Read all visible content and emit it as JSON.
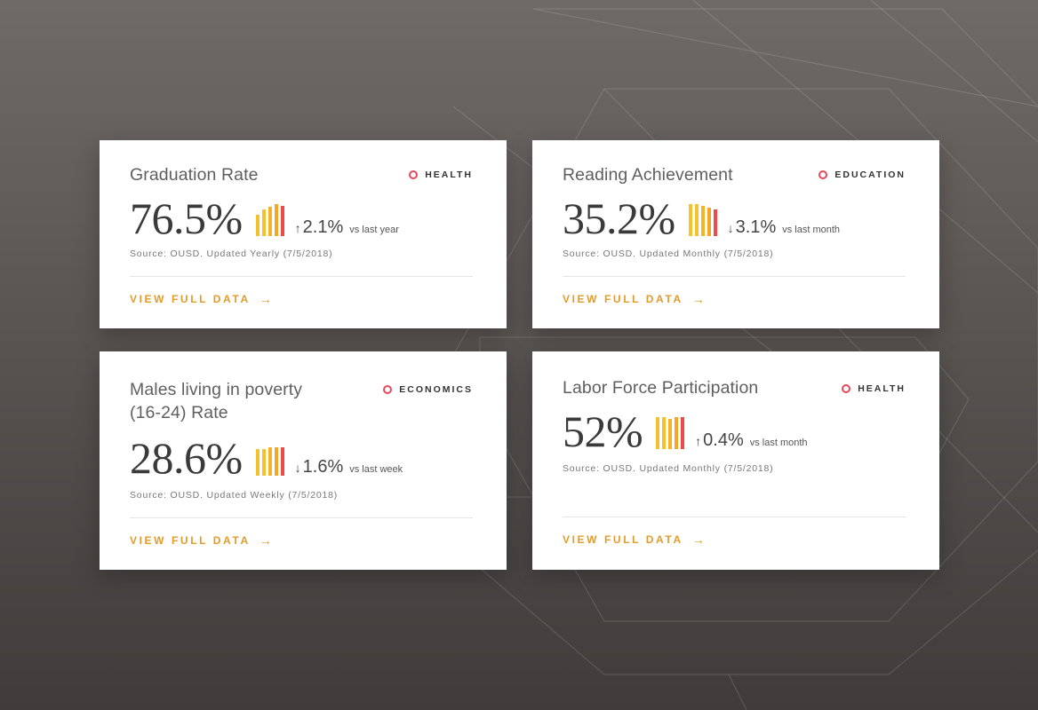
{
  "cta_label": "VIEW FULL DATA",
  "colors": {
    "accent": "#e39b2a",
    "tag_dot": "#e8475a",
    "bar_yellow": "#f7c12e",
    "bar_orange": "#f5a623",
    "bar_red": "#ef4a4a"
  },
  "cards": [
    {
      "title": "Graduation Rate",
      "tag": "HEALTH",
      "value": "76.5%",
      "change_arrow": "↑",
      "change": "2.1%",
      "comparison": "vs last year",
      "source": "Source: OUSD.  Updated Yearly (7/5/2018)"
    },
    {
      "title": "Reading Achievement",
      "tag": "EDUCATION",
      "value": "35.2%",
      "change_arrow": "↓",
      "change": "3.1%",
      "comparison": "vs last month",
      "source": "Source: OUSD.  Updated Monthly (7/5/2018)"
    },
    {
      "title": "Males living in poverty (16-24) Rate",
      "tag": "ECONOMICS",
      "value": "28.6%",
      "change_arrow": "↓",
      "change": "1.6%",
      "comparison": "vs last week",
      "source": "Source: OUSD.  Updated Weekly (7/5/2018)"
    },
    {
      "title": "Labor Force Participation",
      "tag": "HEALTH",
      "value": "52%",
      "change_arrow": "↑",
      "change": "0.4%",
      "comparison": "vs last month",
      "source": "Source: OUSD.  Updated Monthly (7/5/2018)"
    }
  ]
}
